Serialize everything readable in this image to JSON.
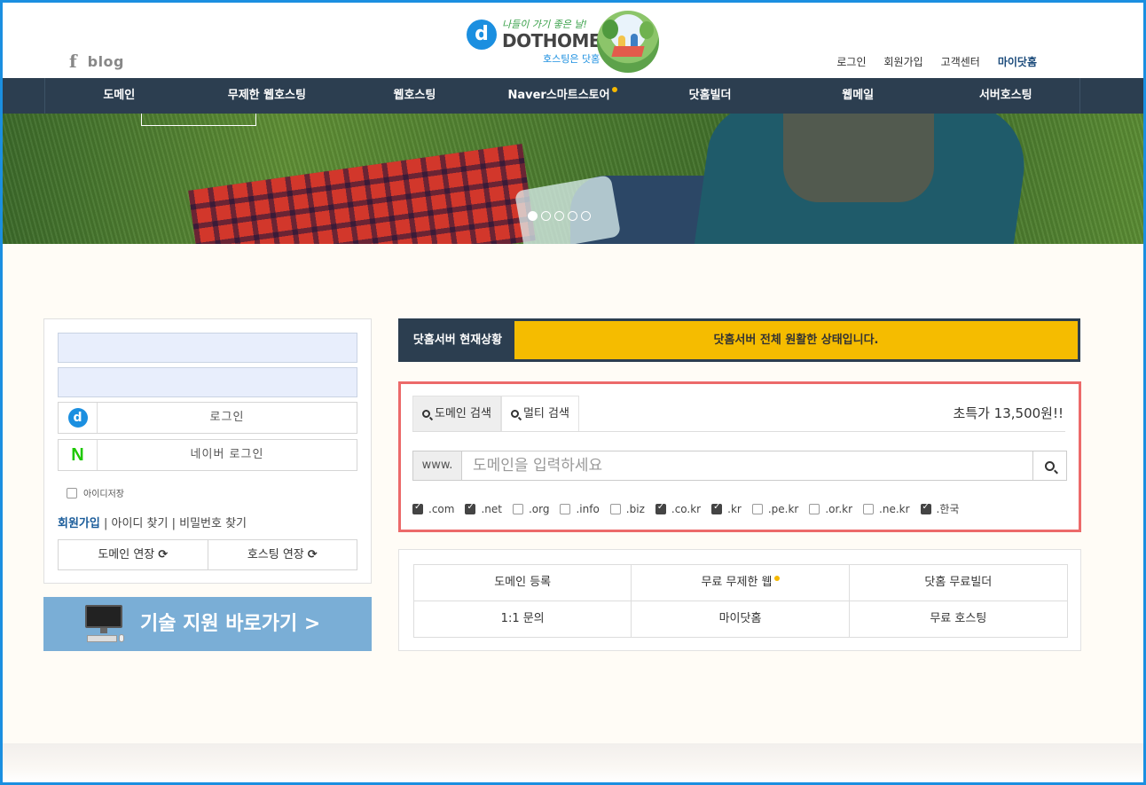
{
  "header": {
    "social": {
      "facebook_glyph": "f",
      "blog": "blog"
    },
    "logo": {
      "slogan": "나들이 가기 좋은 날!",
      "name": "DOTHOME",
      "subtitle": "호스팅은 닷홈",
      "d_glyph": "d"
    },
    "top_links": [
      "로그인",
      "회원가입",
      "고객센터",
      "마이닷홈"
    ]
  },
  "nav": {
    "items": [
      "도메인",
      "무제한 웹호스팅",
      "웹호스팅",
      "Naver스마트스토어",
      "닷홈빌더",
      "웹메일",
      "서버호스팅"
    ],
    "accent_color": "#f5b800"
  },
  "hero": {
    "slides": 5,
    "active_slide": 1
  },
  "login": {
    "login_label": "로그인",
    "naver_label": "네이버 로그인",
    "naver_glyph": "N",
    "save_id": "아이디저장",
    "join": "회원가입",
    "find_id": "아이디 찾기",
    "find_pw": "비밀번호 찾기",
    "separator": "|",
    "domain_renew": "도메인 연장",
    "hosting_renew": "호스팅 연장",
    "refresh_glyph": "⟳"
  },
  "tech_support": {
    "label": "기술 지원 바로가기 >"
  },
  "status": {
    "label": "닷홈서버 현재상황",
    "message": "닷홈서버 전체 원활한 상태입니다.",
    "color": "#f5bc00"
  },
  "search": {
    "tabs": [
      "도메인 검색",
      "멀티 검색"
    ],
    "promo": "초특가 13,500원!!",
    "prefix": "www.",
    "placeholder": "도메인을 입력하세요",
    "tlds": [
      {
        "label": ".com",
        "checked": true
      },
      {
        "label": ".net",
        "checked": true
      },
      {
        "label": ".org",
        "checked": false
      },
      {
        "label": ".info",
        "checked": false
      },
      {
        "label": ".biz",
        "checked": false
      },
      {
        "label": ".co.kr",
        "checked": true
      },
      {
        "label": ".kr",
        "checked": true
      },
      {
        "label": ".pe.kr",
        "checked": false
      },
      {
        "label": ".or.kr",
        "checked": false
      },
      {
        "label": ".ne.kr",
        "checked": false
      },
      {
        "label": ".한국",
        "checked": true
      }
    ],
    "border_color": "#ec6a6a"
  },
  "quick_links": [
    "도메인 등록",
    "무료 무제한 웹",
    "닷홈 무료빌더",
    "1:1 문의",
    "마이닷홈",
    "무료 호스팅"
  ]
}
